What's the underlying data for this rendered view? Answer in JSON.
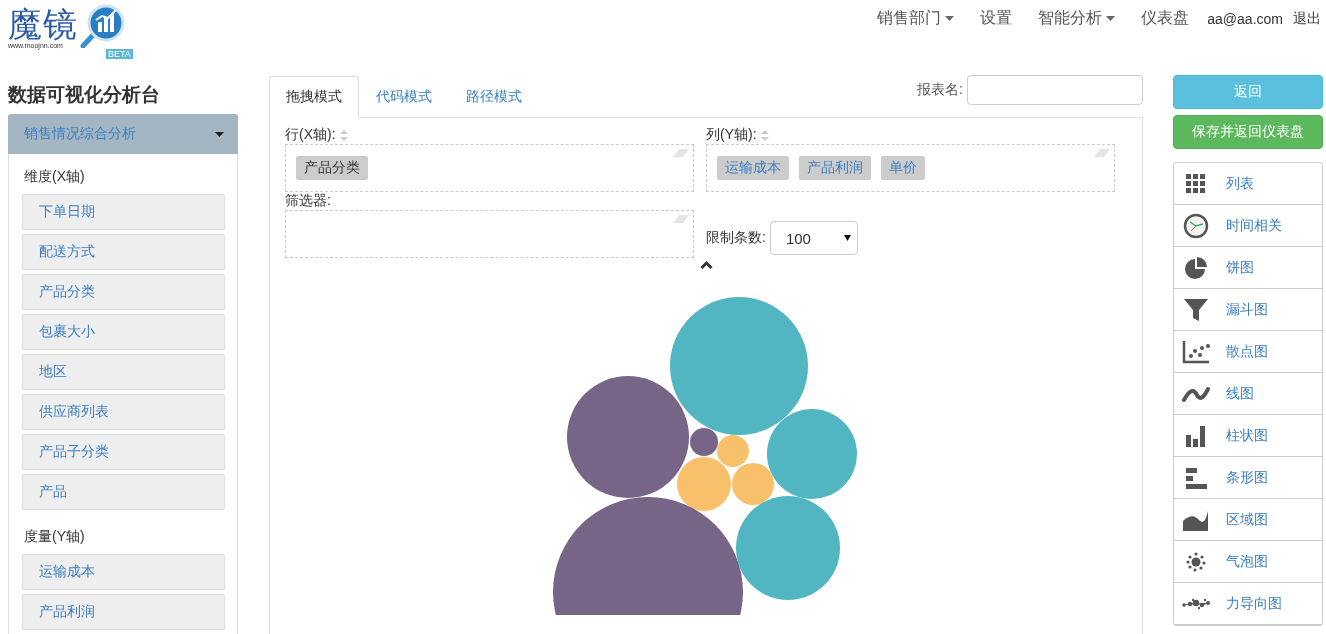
{
  "logo": {
    "name": "魔镜",
    "url": "www.moojnn.com",
    "badge": "BETA"
  },
  "nav": [
    {
      "label": "销售部门",
      "dropdown": true
    },
    {
      "label": "设置",
      "dropdown": false
    },
    {
      "label": "智能分析",
      "dropdown": true
    },
    {
      "label": "仪表盘",
      "dropdown": false
    },
    {
      "label": "aa@aa.com",
      "dropdown": false
    },
    {
      "label": "退出",
      "dropdown": false
    }
  ],
  "sidebar": {
    "title": "数据可视化分析台",
    "accordion": {
      "label": "销售情况综合分析",
      "expanded": true
    },
    "groups": [
      {
        "label": "维度(X轴)",
        "items": [
          "下单日期",
          "配送方式",
          "产品分类",
          "包裹大小",
          "地区",
          "供应商列表",
          "产品子分类",
          "产品"
        ]
      },
      {
        "label": "度量(Y轴)",
        "items": [
          "运输成本",
          "产品利润"
        ]
      }
    ]
  },
  "tabs": [
    {
      "label": "拖拽模式",
      "selected": true
    },
    {
      "label": "代码模式",
      "selected": false
    },
    {
      "label": "路径模式",
      "selected": false
    }
  ],
  "report_name": {
    "label": "报表名:"
  },
  "rows_zone": {
    "label": "行(X轴):",
    "pills": [
      "产品分类"
    ]
  },
  "columns_zone": {
    "label": "列(Y轴):",
    "pills": [
      "运输成本",
      "产品利润",
      "单价"
    ]
  },
  "filter_zone": {
    "label": "筛选器:"
  },
  "limit": {
    "label": "限制条数:",
    "value": "100"
  },
  "buttons": [
    {
      "label": "返回",
      "kind": "info"
    },
    {
      "label": "保存并返回仪表盘",
      "kind": "success"
    }
  ],
  "chart_types": [
    {
      "label": "列表",
      "kind": "grid"
    },
    {
      "label": "时间相关",
      "kind": "clock"
    },
    {
      "label": "饼图",
      "kind": "pie"
    },
    {
      "label": "漏斗图",
      "kind": "funnel"
    },
    {
      "label": "散点图",
      "kind": "scatter"
    },
    {
      "label": "线图",
      "kind": "line"
    },
    {
      "label": "柱状图",
      "kind": "bar"
    },
    {
      "label": "条形图",
      "kind": "hbar"
    },
    {
      "label": "区域图",
      "kind": "area"
    },
    {
      "label": "气泡图",
      "kind": "bubble"
    },
    {
      "label": "力导向图",
      "kind": "force"
    }
  ]
}
